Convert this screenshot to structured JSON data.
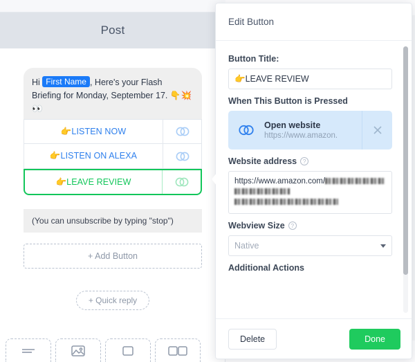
{
  "composer": {
    "header_title": "Post",
    "message": {
      "prefix": "Hi",
      "token": "First Name",
      "body": ", Here's your Flash Briefing for Monday, September 17.",
      "emoji1": "👇",
      "emoji2": "💥",
      "emoji3": "👀"
    },
    "buttons": [
      {
        "label": "👉LISTEN NOW",
        "icon": "link-icon",
        "selected": false
      },
      {
        "label": "👉LISTEN ON ALEXA",
        "icon": "link-icon",
        "selected": false
      },
      {
        "label": "👉LEAVE REVIEW",
        "icon": "link-icon",
        "selected": true
      }
    ],
    "unsubscribe_note": "(You can unsubscribe by typing \"stop\")",
    "add_button_label": "+ Add Button",
    "quick_reply_label": "+ Quick reply",
    "toolbar_icons": [
      "text-lines-icon",
      "image-icon",
      "card-icon",
      "gallery-icon"
    ]
  },
  "panel": {
    "title": "Edit Button",
    "button_title_label": "Button Title:",
    "button_title_value": "👉LEAVE REVIEW",
    "pressed_section_label": "When This Button is Pressed",
    "action": {
      "icon": "link-icon",
      "title": "Open website",
      "subtitle": "https://www.amazon.",
      "remove_icon": "close-icon"
    },
    "website_address_label": "Website address",
    "website_address_help": "?",
    "website_address_value": "https://www.amazon.com/",
    "webview_size_label": "Webview Size",
    "webview_size_help": "?",
    "webview_size_value": "Native",
    "additional_actions_label": "Additional Actions",
    "delete_label": "Delete",
    "done_label": "Done"
  },
  "colors": {
    "accent_blue": "#2f80ed",
    "selected_green": "#12c65a",
    "done_green": "#1fcb5e",
    "token_blue": "#1a7af8",
    "header_band": "#dfe3e9",
    "action_card": "#d6e9fb"
  }
}
